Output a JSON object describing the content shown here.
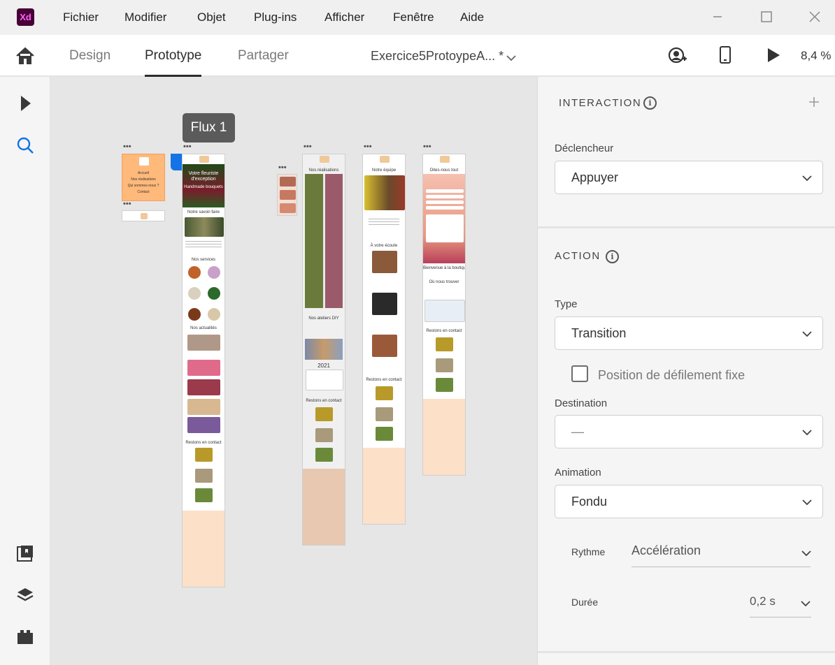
{
  "app": {
    "logo_text": "Xd"
  },
  "menubar": {
    "items": [
      "Fichier",
      "Modifier",
      "Objet",
      "Plug-ins",
      "Afficher",
      "Fenêtre",
      "Aide"
    ]
  },
  "toolbar": {
    "tabs": [
      "Design",
      "Prototype",
      "Partager"
    ],
    "active_tab": "Prototype",
    "document_name": "Exercice5ProtoypeA... *",
    "zoom": "8,4 %"
  },
  "canvas": {
    "flow_label": "Flux 1",
    "artboards": {
      "menu": {
        "items": [
          "Accueil",
          "Nos réalisations",
          "Qui sommes-nous ?",
          "Contact"
        ]
      },
      "home": {
        "hero": "Votre fleuriste d'exception",
        "hero_sub": "Handmade bouquets",
        "savoir": "Notre savoir-faire",
        "services": "Nos services",
        "actualites": "Nos actualités",
        "contact": "Restons en contact"
      },
      "realisations": {
        "title": "Nos réalisations",
        "ateliers": "Nos ateliers DIY",
        "year": "2021",
        "contact": "Restons en contact"
      },
      "equipe": {
        "title": "Notre équipe",
        "ecoute": "À votre écoute",
        "contact": "Restons en contact"
      },
      "contact": {
        "title": "Dites-nous tout",
        "bienvenue": "Bienvenue à la boutique",
        "ou": "Où nous trouver",
        "contact": "Restons en contact"
      }
    }
  },
  "panel": {
    "interaction_title": "INTERACTION",
    "trigger_label": "Déclencheur",
    "trigger_value": "Appuyer",
    "action_title": "ACTION",
    "type_label": "Type",
    "type_value": "Transition",
    "fixed_scroll_label": "Position de défilement fixe",
    "fixed_scroll_checked": false,
    "destination_label": "Destination",
    "destination_value": "—",
    "animation_label": "Animation",
    "animation_value": "Fondu",
    "easing_label": "Rythme",
    "easing_value": "Accélération",
    "duration_label": "Durée",
    "duration_value": "0,2 s"
  },
  "colors": {
    "accent": "#1473e6",
    "peach": "#fde0c8",
    "salmon": "#f0a886",
    "orange_menu": "#ffb97a"
  }
}
